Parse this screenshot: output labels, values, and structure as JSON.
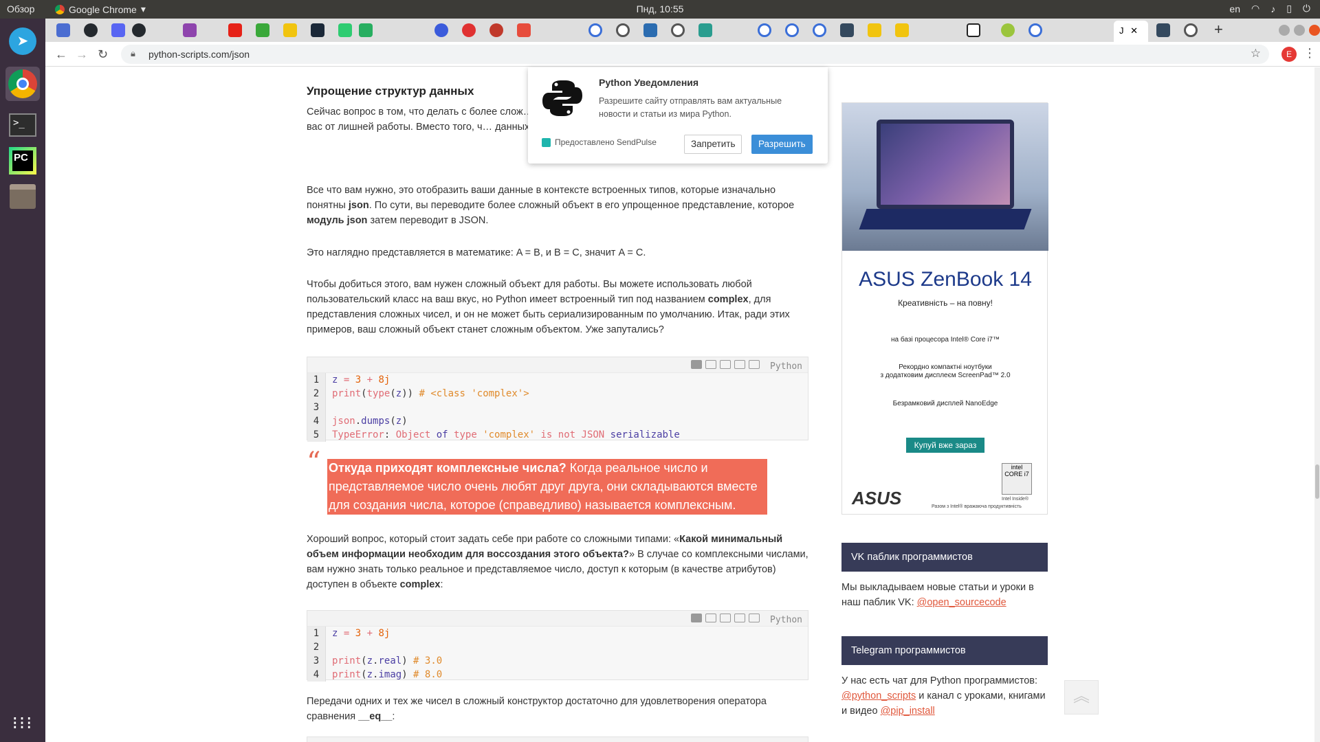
{
  "topbar": {
    "overview": "Обзор",
    "app_name": "Google Chrome",
    "clock": "Пнд, 10:55",
    "lang": "en"
  },
  "browser": {
    "url": "python-scripts.com/json",
    "profile_initial": "E",
    "active_tab_label": "J"
  },
  "colors": {
    "accent": "#e0573b",
    "quote_bg": "#f06c58",
    "sidebar_header": "#373b58",
    "allow_button": "#3b8ed8"
  },
  "article": {
    "heading": "Упрощение структур данных",
    "p1": "Сейчас вопрос в том, что делать с более слож… попробовать кодировать и декодировать JSO… избавит вас от лишней работы. Вместо того, ч… данных к JSON, вы можете перейти к промеж…",
    "p2_a": "Все что вам нужно, это отобразить ваши данные в контексте встроенных типов, которые изначально понятны ",
    "p2_b": "json",
    "p2_c": ". По сути, вы переводите более сложный объект в его упрощенное представление, которое ",
    "p2_d": "модуль json",
    "p2_e": " затем переводит в JSON.",
    "p3": "Это наглядно представляется в математике: A = B, и B = C, значит A = C.",
    "p4_a": "Чтобы добиться этого, вам нужен сложный объект для работы. Вы можете использовать любой пользовательский класс на ваш вкус, но Python имеет встроенный тип под названием ",
    "p4_b": "complex",
    "p4_c": ", для представления сложных чисел, и он не может быть сериализированным по умолчанию. Итак, ради этих примеров, ваш сложный объект станет сложным объектом. Уже запутались?",
    "code_lang": "Python",
    "code1": [
      "z = 3 + 8j",
      "print(type(z)) # <class 'complex'>",
      "",
      "json.dumps(z)",
      "TypeError: Object of type 'complex' is not JSON serializable"
    ],
    "quote_bold": "Откуда приходят комплексные числа?",
    "quote_text": " Когда реальное число и представляемое число очень любят друг друга, они складываются вместе для создания числа, которое (справедливо) называется комплексным.",
    "p5_a": "Хороший вопрос, который стоит задать себе при работе со сложными типами: «",
    "p5_b": "Какой минимальный объем информации необходим для воссоздания этого объекта?",
    "p5_c": "» В случае со комплексными числами, вам нужно знать только реальное и представляемое число, доступ к которым (в качестве атрибутов) доступен в объекте ",
    "p5_d": "complex",
    "p5_e": ":",
    "code2": [
      "z = 3 + 8j",
      "",
      "print(z.real) # 3.0",
      "print(z.imag) # 8.0"
    ],
    "p6_a": "Передачи одних и тех же чисел в сложный конструктор достаточно для удовлетворения оператора сравнения ",
    "p6_b": "__eq__",
    "p6_c": ":"
  },
  "popup": {
    "title": "Python Уведомления",
    "body": "Разрешите сайту отправлять вам актуальные новости и статьи из мира Python.",
    "provided_by": "Предоставлено SendPulse",
    "deny": "Запретить",
    "allow": "Разрешить"
  },
  "ad": {
    "brand": "ASUS ZenBook 14",
    "tagline": "Креативність – на повну!",
    "line1": "на базі процесора Intel® Core i7™",
    "line2a": "Рекордно компактні ноутбуки",
    "line2b": "з додатковим дисплеєм ScreenPad™ 2.0",
    "line3": "Безрамковий дисплей NanoEdge",
    "buy": "Купуй вже зараз",
    "asus_logo": "ASUS",
    "intel_badge": "intel CORE i7",
    "intel_inside": "Intel Inside®",
    "footnote": "Разом з Intel® вражаюча продуктивність"
  },
  "sidebar": {
    "vk_header": "VK паблик программистов",
    "vk_text": "Мы выкладываем новые статьи и уроки в наш паблик VK: ",
    "vk_link": "@open_sourcecode",
    "tg_header": "Telegram программистов",
    "tg_text_a": "У нас есть чат для Python программистов: ",
    "tg_link1": "@python_scripts",
    "tg_text_b": " и канал с уроками, книгами и видео ",
    "tg_link2": "@pip_install"
  }
}
